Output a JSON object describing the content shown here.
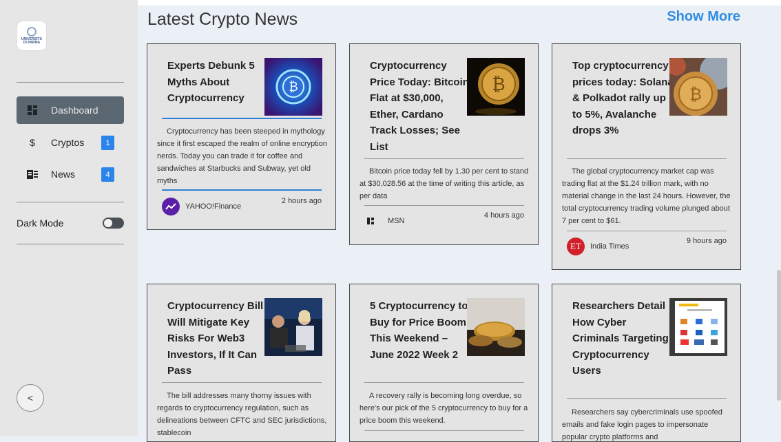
{
  "sidebar": {
    "logo_text_1": "UNIVERSITÀ",
    "logo_text_2": "DI PARMA",
    "items": [
      {
        "label": "Dashboard",
        "icon": "dashboard-icon"
      },
      {
        "label": "Cryptos",
        "icon": "dollar-icon",
        "badge": "1"
      },
      {
        "label": "News",
        "icon": "newspaper-icon",
        "badge": "4"
      }
    ],
    "dark_mode_label": "Dark Mode",
    "collapse_glyph": "<"
  },
  "header": {
    "title": "Latest Crypto News",
    "show_more": "Show More"
  },
  "cards": [
    {
      "title": "Experts Debunk 5 Myths About Cryptocurrency",
      "desc": "Cryptocurrency has been steeped in mythology since it first escaped the realm of online encryption nerds. Today you can trade it for coffee and sandwiches at Starbucks and Subway, yet old myths",
      "source": "YAHOO!Finance",
      "time": "2 hours ago"
    },
    {
      "title": "Cryptocurrency Price Today: Bitcoin Flat at $30,000, Ether, Cardano Track Losses; See List",
      "desc": "Bitcoin price today fell by 1.30 per cent to stand at $30,028.56 at the time of writing this article, as per data",
      "source": "MSN",
      "time": "4 hours ago"
    },
    {
      "title": "Top cryptocurrency prices today: Solana & Polkadot rally up to 5%, Avalanche drops 3%",
      "desc": "The global cryptocurrency market cap was trading flat at the $1.24 trillion mark, with no material change in the last 24 hours. However, the total cryptocurrency trading volume plunged about 7 per cent to $61.",
      "source": "India Times",
      "source_logo": "ET",
      "time": "9 hours ago"
    },
    {
      "title": "Cryptocurrency Bill Will Mitigate Key Risks For Web3 Investors, If It Can Pass",
      "desc": "The bill addresses many thorny issues with regards to cryptocurrency regulation, such as delineations between CFTC and SEC jurisdictions, stablecoin"
    },
    {
      "title": "5 Cryptocurrency to Buy for Price Boom This Weekend – June 2022 Week 2",
      "desc": "A recovery rally is becoming long overdue, so here's our pick of the 5 cryptocurrency to buy for a price boom this weekend."
    },
    {
      "title": "Researchers Detail How Cyber Criminals Targeting Cryptocurrency Users",
      "desc": "Researchers say cybercriminals use spoofed emails and fake login pages to impersonate popular crypto platforms and"
    }
  ]
}
